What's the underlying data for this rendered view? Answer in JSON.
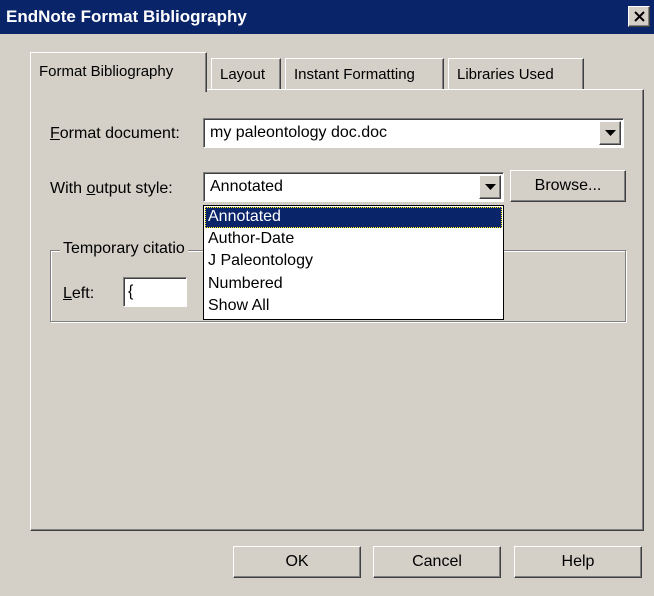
{
  "window": {
    "title": "EndNote Format Bibliography"
  },
  "tabs": [
    {
      "label": "Format Bibliography",
      "active": true
    },
    {
      "label": "Layout",
      "active": false
    },
    {
      "label": "Instant Formatting",
      "active": false
    },
    {
      "label": "Libraries Used",
      "active": false
    }
  ],
  "format_document": {
    "label_mnemonic": "F",
    "label_rest": "ormat document:",
    "value": "my paleontology doc.doc"
  },
  "output_style": {
    "label_pre": "With ",
    "label_mnemonic": "o",
    "label_rest": "utput style:",
    "value": "Annotated",
    "browse_label": "Browse...",
    "options": [
      "Annotated",
      "Author-Date",
      "J Paleontology",
      "Numbered",
      "Show All"
    ],
    "selected_option": "Annotated"
  },
  "temporary_citations": {
    "legend": "Temporary citatio",
    "left_label_mnemonic": "L",
    "left_label_rest": "eft:",
    "left_value": "{"
  },
  "buttons": {
    "ok": "OK",
    "cancel": "Cancel",
    "help": "Help"
  },
  "icons": {
    "close": "close-icon",
    "dropdown": "chevron-down-icon"
  },
  "colors": {
    "title_bar": "#0a246a",
    "dialog_bg": "#d4d0c8",
    "selection": "#0a246a"
  }
}
